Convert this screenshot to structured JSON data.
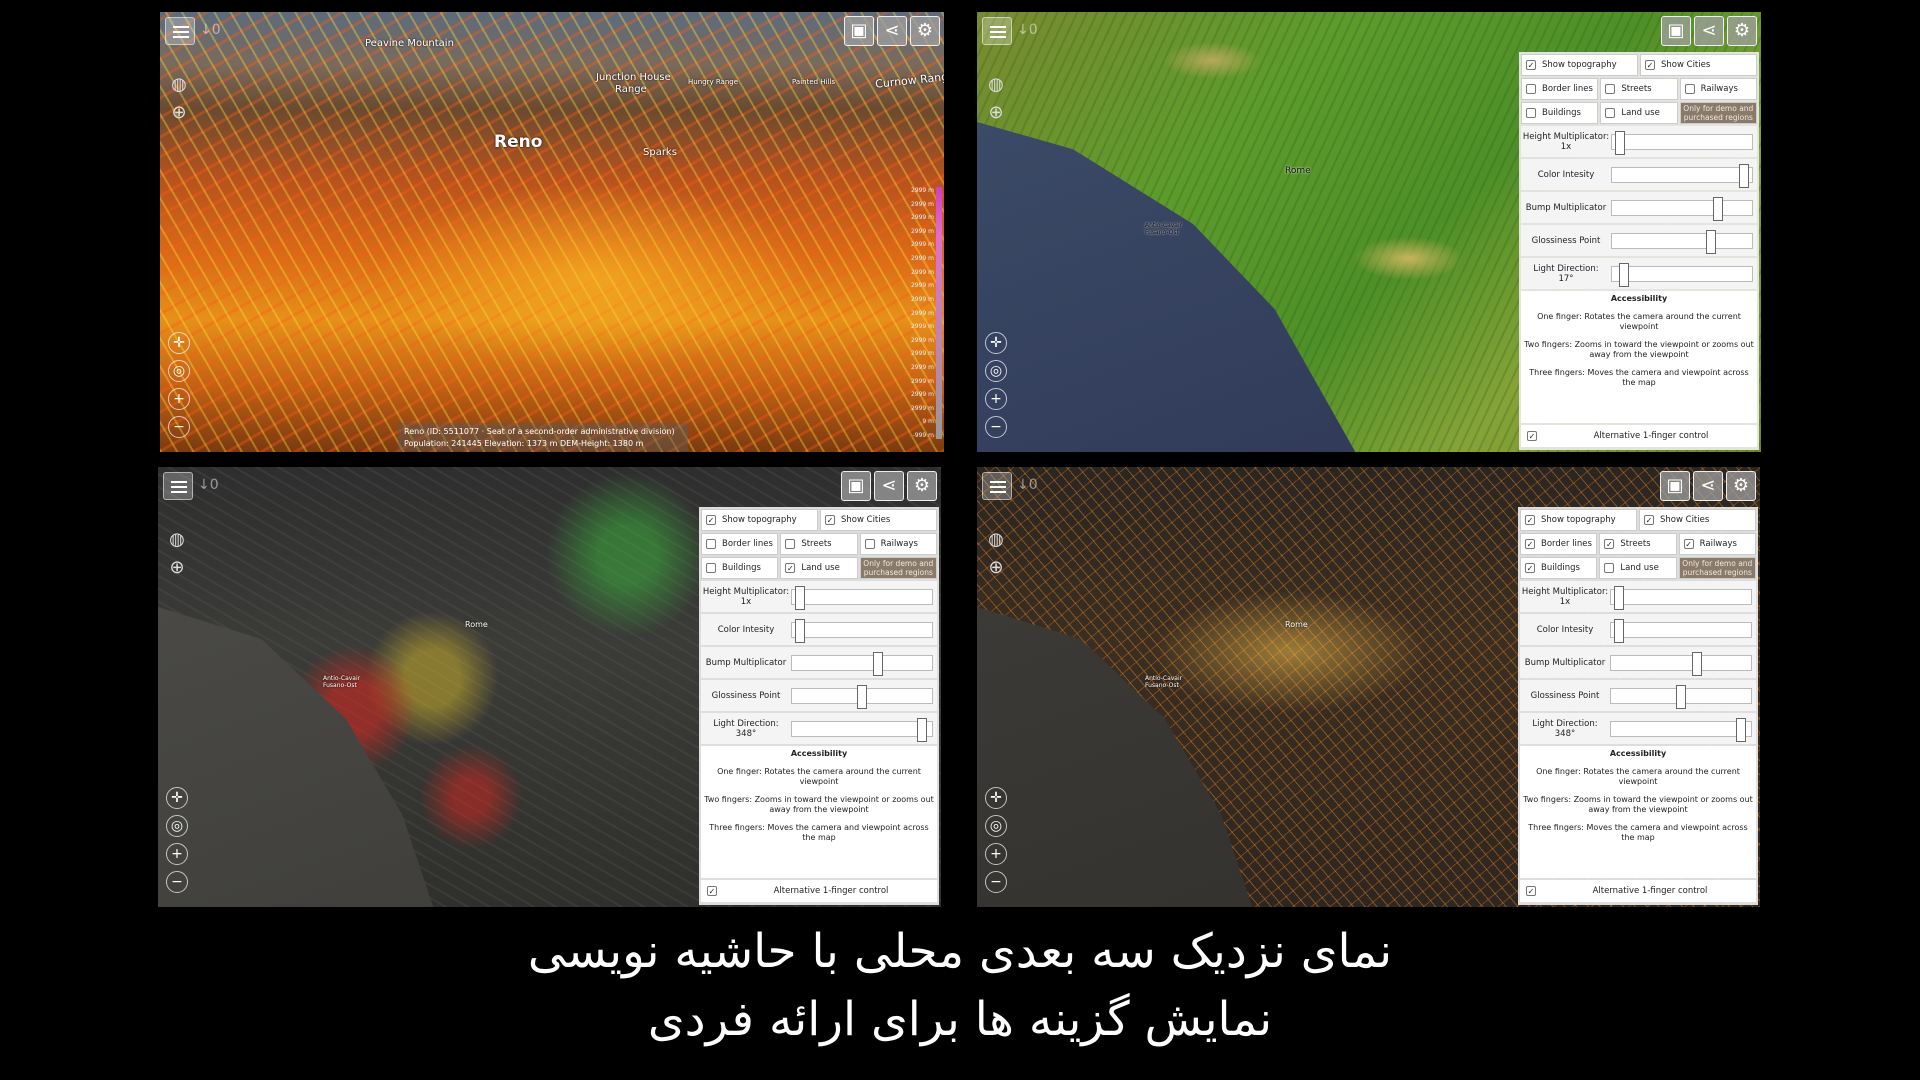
{
  "caption": {
    "line1": "نمای نزدیک سه بعدی محلی با حاشیه نویسی",
    "line2": "نمایش گزینه ها برای ارائه فردی"
  },
  "icons": {
    "menu": "menu-icon",
    "terrain_image": "image-icon",
    "share": "share-icon",
    "settings": "gear-icon",
    "globe": "globe-icon",
    "grid_globe": "wireframe-globe-icon",
    "pan": "pan-icon",
    "rotate": "rotate-icon",
    "zoom_in": "zoom-in-icon",
    "zoom_out": "zoom-out-icon"
  },
  "toolbar": {
    "counter": "↓0",
    "menu_glyph": "≡",
    "image_glyph": "▣",
    "share_glyph": "⋖",
    "settings_glyph": "⚙",
    "pan_glyph": "✛",
    "rotate_glyph": "◎",
    "zoom_in_glyph": "+",
    "zoom_out_glyph": "−"
  },
  "pane1": {
    "labels": {
      "peavine": "Peavine Mountain",
      "junction": "Junction House",
      "range": "Range",
      "curnow": "Curnow Rang",
      "hungry": "Hungry Range",
      "painted": "Painted Hills",
      "reno": "Reno",
      "sparks": "Sparks"
    },
    "info": {
      "line1": "Reno   (ID: 5511077  ·  Seat of a second-order administrative division)",
      "line2": "Population: 241445        Elevation: 1373 m        DEM-Height: 1380 m"
    },
    "legend_values": [
      "2999 m",
      "2999 m",
      "2999 m",
      "2999 m",
      "2999 m",
      "2999 m",
      "2999 m",
      "2999 m",
      "2999 m",
      "2999 m",
      "2999 m",
      "2999 m",
      "2999 m",
      "2999 m",
      "2999 m",
      "2999 m",
      "2999 m",
      "9 m",
      "-999 m"
    ]
  },
  "pane2": {
    "labels": {
      "rome": "Rome",
      "anzio": "Antio-Cavair Fusano-Ost"
    }
  },
  "pane3": {
    "labels": {
      "rome": "Rome",
      "anzio": "Antio-Cavair Fusano-Ost"
    }
  },
  "pane4": {
    "labels": {
      "rome": "Rome",
      "anzio": "Antio-Cavair Fusano-Ost"
    }
  },
  "panel_text": {
    "show_topography": "Show topography",
    "show_cities": "Show Cities",
    "border_lines": "Border lines",
    "streets": "Streets",
    "railways": "Railways",
    "buildings": "Buildings",
    "land_use": "Land use",
    "demo_note": "Only for demo and purchased regions",
    "height_multiplicator": "Height Multiplicator:",
    "height_value": "1x",
    "color_intensity": "Color Intesity",
    "bump_multiplicator": "Bump Multiplicator",
    "glossiness_point": "Glossiness Point",
    "light_direction": "Light Direction:",
    "accessibility": "Accessibility",
    "acc_one": "One finger: Rotates the camera around the current viewpoint",
    "acc_two": "Two fingers: Zooms in toward the viewpoint or zooms out away from the viewpoint",
    "acc_three": "Three fingers: Moves the camera and viewpoint across the map",
    "alt_control": "Alternative 1-finger control",
    "check": "✓"
  },
  "panels": [
    {
      "pane": "pane2",
      "light_value": "17°",
      "checks": {
        "topography": true,
        "cities": true,
        "border": false,
        "streets": false,
        "railways": false,
        "buildings": false,
        "landuse": false,
        "alt": true
      },
      "sliders": {
        "height": 0.02,
        "color": 0.98,
        "bump": 0.78,
        "gloss": 0.72,
        "light": 0.05
      }
    },
    {
      "pane": "pane3",
      "light_value": "348°",
      "checks": {
        "topography": true,
        "cities": true,
        "border": false,
        "streets": false,
        "railways": false,
        "buildings": false,
        "landuse": true,
        "alt": true
      },
      "sliders": {
        "height": 0.02,
        "color": 0.02,
        "bump": 0.62,
        "gloss": 0.5,
        "light": 0.96
      }
    },
    {
      "pane": "pane4",
      "light_value": "348°",
      "checks": {
        "topography": true,
        "cities": true,
        "border": true,
        "streets": true,
        "railways": true,
        "buildings": true,
        "landuse": false,
        "alt": true
      },
      "sliders": {
        "height": 0.02,
        "color": 0.02,
        "bump": 0.62,
        "gloss": 0.5,
        "light": 0.96
      }
    }
  ]
}
